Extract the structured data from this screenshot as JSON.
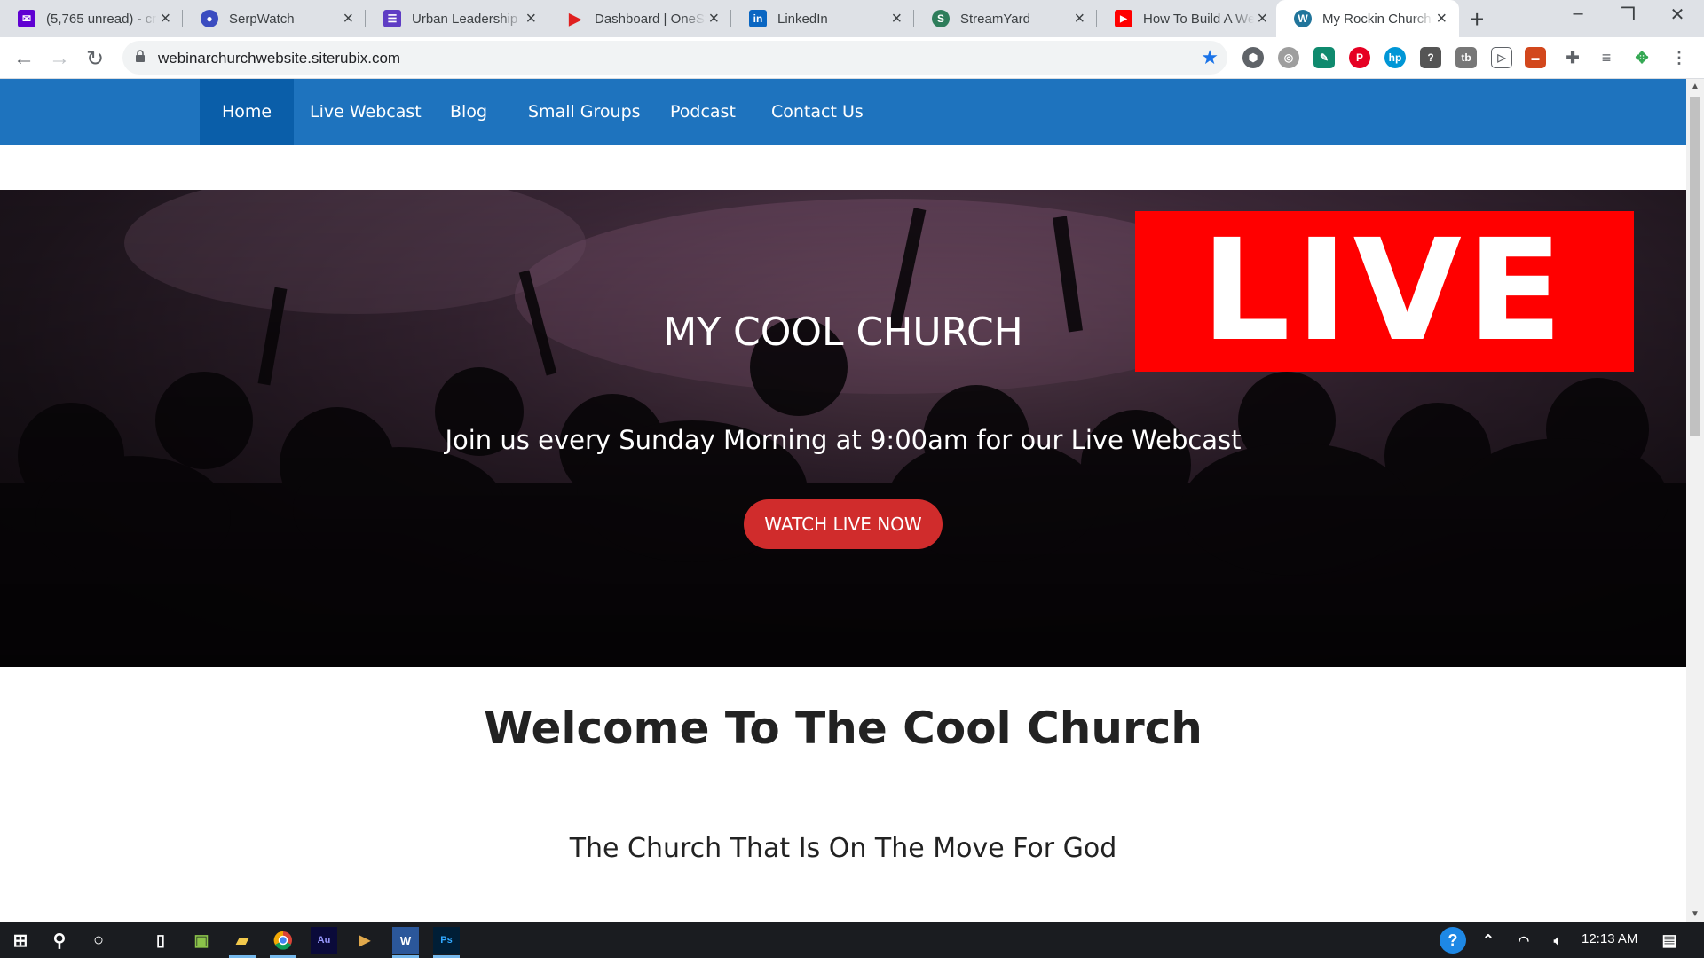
{
  "browser": {
    "tabs": [
      {
        "title": "(5,765 unread) - cr",
        "icon": "yahoo-mail-icon",
        "color": "#6001d2"
      },
      {
        "title": "SerpWatch",
        "icon": "serpwatch-icon",
        "color": "#3b4cc0"
      },
      {
        "title": "Urban Leadership",
        "icon": "list-icon",
        "color": "#5f3dc4"
      },
      {
        "title": "Dashboard | OneSt",
        "icon": "play-icon",
        "color": "#e02020"
      },
      {
        "title": "LinkedIn",
        "icon": "linkedin-icon",
        "color": "#0a66c2"
      },
      {
        "title": "StreamYard",
        "icon": "streamyard-icon",
        "color": "#2e7d5b"
      },
      {
        "title": "How To Build A We",
        "icon": "youtube-icon",
        "color": "#ff0000"
      },
      {
        "title": "My Rockin Church",
        "icon": "wordpress-icon",
        "color": "#21759b",
        "active": true
      }
    ],
    "url": "webinarchurchwebsite.siterubix.com"
  },
  "site": {
    "nav": [
      "Home",
      "Live Webcast",
      "Blog",
      "Small Groups",
      "Podcast",
      "Contact Us"
    ],
    "hero": {
      "title": "MY COOL CHURCH",
      "tagline": "Join us every Sunday Morning at 9:00am for our Live Webcast",
      "cta": "WATCH LIVE NOW",
      "badge": "LIVE"
    },
    "welcome": "Welcome To The Cool Church",
    "subline": "The Church That Is On The Move For God"
  },
  "taskbar": {
    "clock": "12:13 AM"
  },
  "colors": {
    "nav_bg": "#1e73be",
    "nav_active": "#0a5ea9",
    "cta": "#d02c2c",
    "live_badge": "#ff0000"
  }
}
